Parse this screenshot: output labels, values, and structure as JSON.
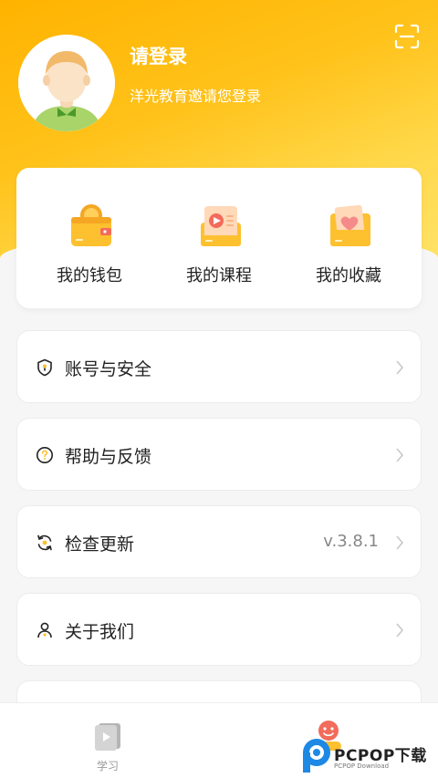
{
  "profile": {
    "title": "请登录",
    "subtitle": "洋光教育邀请您登录"
  },
  "quick_actions": [
    {
      "label": "我的钱包",
      "icon": "wallet-icon"
    },
    {
      "label": "我的课程",
      "icon": "course-icon"
    },
    {
      "label": "我的收藏",
      "icon": "favorite-folder-icon"
    }
  ],
  "menu": [
    {
      "label": "账号与安全",
      "icon": "shield-key-icon",
      "value": ""
    },
    {
      "label": "帮助与反馈",
      "icon": "help-circle-icon",
      "value": ""
    },
    {
      "label": "检查更新",
      "icon": "refresh-icon",
      "value": "v.3.8.1"
    },
    {
      "label": "关于我们",
      "icon": "person-icon",
      "value": ""
    }
  ],
  "tabbar": {
    "study_label": "学习"
  },
  "watermark": {
    "text": "PCPOP下载",
    "sub": "PCPOP Download"
  },
  "colors": {
    "accent": "#ffb300",
    "icon_bg": "#fdc02f"
  }
}
